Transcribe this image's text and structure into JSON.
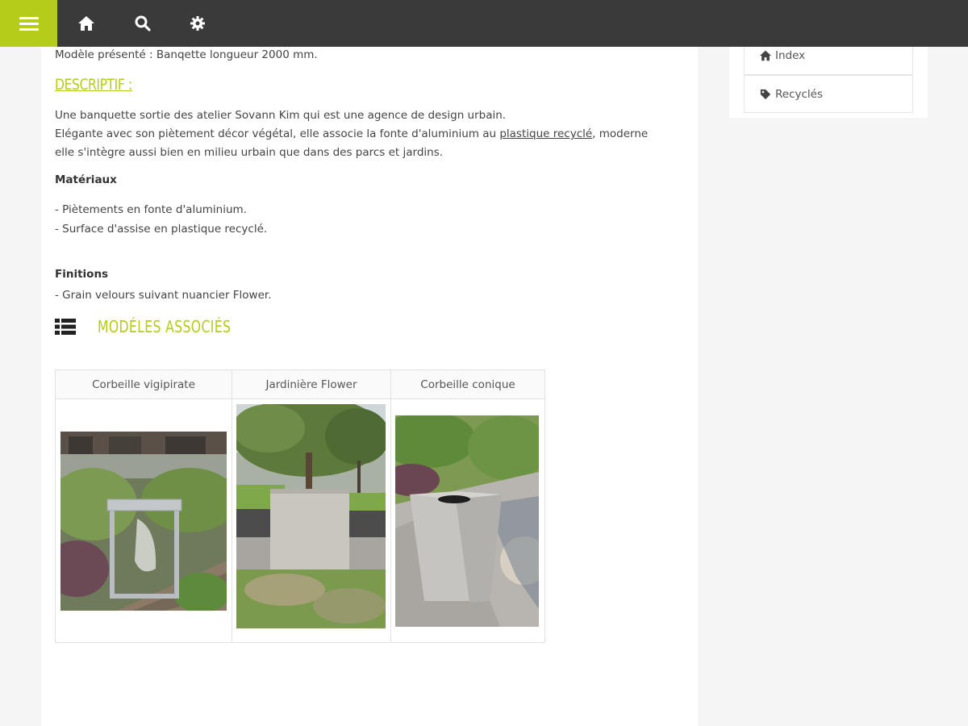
{
  "topbar": {
    "menu_icon": "hamburger-icon",
    "icons": [
      "home-icon",
      "search-icon",
      "gear-icon"
    ],
    "accent": "#b5cc18",
    "bg": "#3a3a3a"
  },
  "product": {
    "model_line": "Modèle présenté : Banqette  longueur 2000 mm.",
    "descriptif_heading": "DESCRIPTIF :",
    "desc_line1": "Une banquette sortie des atelier Sovann Kim qui est une agence de design urbain.",
    "desc_line2_a": "Elégante  avec son piètement décor  végétal, elle associe la fonte d'aluminium au ",
    "desc_line2_link": "plastique recyclé",
    "desc_line2_b": ", moderne",
    "desc_line3": "elle  s'intègre aussi bien en milieu urbain que dans des parcs et jardins.",
    "materiaux_label": "Matériaux",
    "materiaux_items": [
      "- Piètements en fonte d'aluminium.",
      "-  Surface d'assise en plastique recyclé."
    ],
    "finitions_label": "Finitions",
    "finitions_items": [
      "- Grain velours suivant nuancier Flower."
    ]
  },
  "associated": {
    "heading": "Modéles  Associés",
    "icon": "list-icon",
    "models": [
      {
        "name": "Corbeille vigipirate"
      },
      {
        "name": "Jardinière Flower"
      },
      {
        "name": "Corbeille conique"
      }
    ]
  },
  "sidebar": {
    "items": [
      {
        "label": "Index",
        "icon": "home-icon"
      },
      {
        "label": "Recyclés",
        "icon": "tag-icon"
      }
    ]
  }
}
